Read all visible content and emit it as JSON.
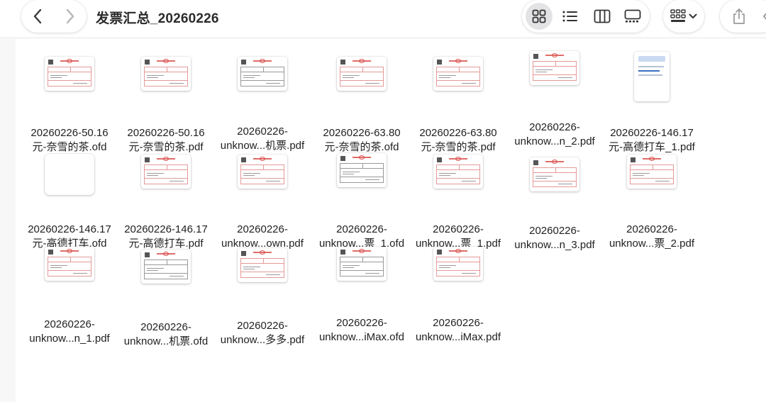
{
  "window": {
    "title": "发票汇总_20260226"
  },
  "toolbar": {
    "back_icon": "chevron-left-icon",
    "forward_icon": "chevron-right-icon",
    "views": [
      {
        "name": "grid-view-icon",
        "active": true
      },
      {
        "name": "list-view-icon",
        "active": false
      },
      {
        "name": "column-view-icon",
        "active": false
      },
      {
        "name": "gallery-view-icon",
        "active": false
      }
    ],
    "group_icon": "group-by-icon",
    "share_icon": "share-icon"
  },
  "files": [
    {
      "name1": "20260226-50.16",
      "name2": "元-奈雪的茶.ofd",
      "thumb": "land-red"
    },
    {
      "name1": "20260226-50.16",
      "name2": "元-奈雪的茶.pdf",
      "thumb": "land-red"
    },
    {
      "name1": "20260226-",
      "name2": "unknow...机票.pdf",
      "thumb": "land-gray"
    },
    {
      "name1": "20260226-63.80",
      "name2": "元-奈雪的茶.ofd",
      "thumb": "land-red"
    },
    {
      "name1": "20260226-63.80",
      "name2": "元-奈雪的茶.pdf",
      "thumb": "land-red"
    },
    {
      "name1": "20260226-",
      "name2": "unknow...n_2.pdf",
      "thumb": "land-red"
    },
    {
      "name1": "20260226-146.17",
      "name2": "元-高德打车_1.pdf",
      "thumb": "portrait"
    },
    {
      "name1": "20260226-146.17",
      "name2": "元-高德打车.ofd",
      "thumb": "blank"
    },
    {
      "name1": "20260226-146.17",
      "name2": "元-高德打车.pdf",
      "thumb": "land-red"
    },
    {
      "name1": "20260226-",
      "name2": "unknow...own.pdf",
      "thumb": "land-red"
    },
    {
      "name1": "20260226-",
      "name2": "unknow...票_1.ofd",
      "thumb": "land-gray"
    },
    {
      "name1": "20260226-",
      "name2": "unknow...票_1.pdf",
      "thumb": "land-red"
    },
    {
      "name1": "20260226-",
      "name2": "unknow...n_3.pdf",
      "thumb": "land-red"
    },
    {
      "name1": "20260226-",
      "name2": "unknow...票_2.pdf",
      "thumb": "land-red"
    },
    {
      "name1": "20260226-",
      "name2": "unknow...n_1.pdf",
      "thumb": "land-red"
    },
    {
      "name1": "20260226-",
      "name2": "unknow...机票.ofd",
      "thumb": "land-gray"
    },
    {
      "name1": "20260226-",
      "name2": "unknow...多多.pdf",
      "thumb": "land-red"
    },
    {
      "name1": "20260226-",
      "name2": "unknow...iMax.ofd",
      "thumb": "land-gray"
    },
    {
      "name1": "20260226-",
      "name2": "unknow...iMax.pdf",
      "thumb": "land-red"
    }
  ]
}
